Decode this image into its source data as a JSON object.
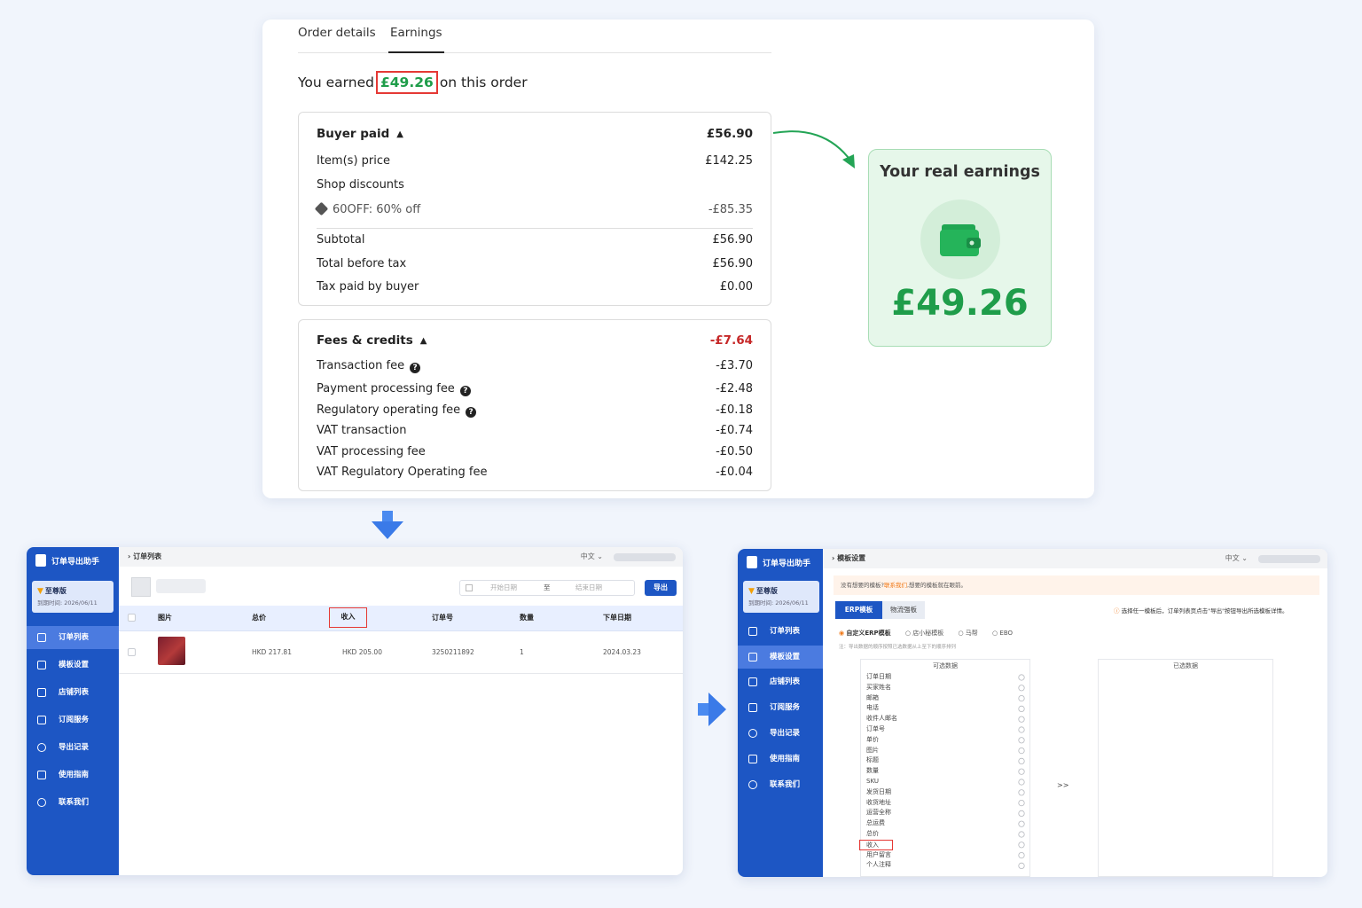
{
  "etsy": {
    "tabs": [
      "Order details",
      "Earnings"
    ],
    "earned_prefix": "You earned",
    "earned_amount": "£49.26",
    "earned_suffix": "on this order",
    "buyer": {
      "title": "Buyer paid",
      "total": "£56.90",
      "items_price_label": "Item(s) price",
      "items_price": "£142.25",
      "shop_discounts_label": "Shop discounts",
      "coupon_label": "60OFF: 60% off",
      "coupon_value": "-£85.35",
      "subtotal_label": "Subtotal",
      "subtotal": "£56.90",
      "before_tax_label": "Total before tax",
      "before_tax": "£56.90",
      "tax_label": "Tax paid by buyer",
      "tax": "£0.00"
    },
    "fees": {
      "title": "Fees & credits",
      "total": "-£7.64",
      "items": [
        {
          "label": "Transaction fee",
          "value": "-£3.70"
        },
        {
          "label": "Payment processing fee",
          "value": "-£2.48"
        },
        {
          "label": "Regulatory operating fee",
          "value": "-£0.18"
        },
        {
          "label": "VAT transaction",
          "value": "-£0.74"
        },
        {
          "label": "VAT processing fee",
          "value": "-£0.50"
        },
        {
          "label": "VAT Regulatory Operating fee",
          "value": "-£0.04"
        }
      ]
    }
  },
  "real": {
    "title": "Your real earnings",
    "amount": "£49.26"
  },
  "app": {
    "brand": "订单导出助手",
    "version": "至尊版",
    "expiry": "到期时间: 2026/06/11",
    "nav": [
      "订单列表",
      "模板设置",
      "店铺列表",
      "订阅服务",
      "导出记录",
      "使用指南",
      "联系我们"
    ],
    "lang": "中文"
  },
  "left": {
    "breadcrumb": "订单列表",
    "start_placeholder": "开始日期",
    "to": "至",
    "end_placeholder": "结束日期",
    "export_btn": "导出",
    "headers": [
      "图片",
      "总价",
      "收入",
      "订单号",
      "数量",
      "下单日期"
    ],
    "row": {
      "total": "HKD 217.81",
      "income": "HKD 205.00",
      "order_no": "3250211892",
      "qty": "1",
      "date": "2024.03.23"
    }
  },
  "right": {
    "breadcrumb": "模板设置",
    "notice_prefix": "没有想要的模板?",
    "notice_link": "联系我们",
    "notice_suffix": ",想要的模板就在眼前。",
    "tab_erp": "ERP模板",
    "tab_logistics": "物流强板",
    "hint": "选择任一模板后，订单列表页点击\"导出\"按钮导出所选模板详情。",
    "radios": [
      "自定义ERP模板",
      "店小秘模板",
      "马帮",
      "EBO"
    ],
    "note": "注：导出数据的顺序按照已选数据从上至下的顺序排列",
    "available_title": "可选数据",
    "selected_title": "已选数据",
    "move": ">>",
    "fields": [
      "订单日期",
      "买家姓名",
      "邮箱",
      "电话",
      "收件人邮名",
      "订单号",
      "单价",
      "图片",
      "标题",
      "数量",
      "SKU",
      "发货日期",
      "收货地址",
      "运营全称",
      "总运费",
      "总价",
      "收入",
      "用户留言",
      "个人注释"
    ]
  }
}
